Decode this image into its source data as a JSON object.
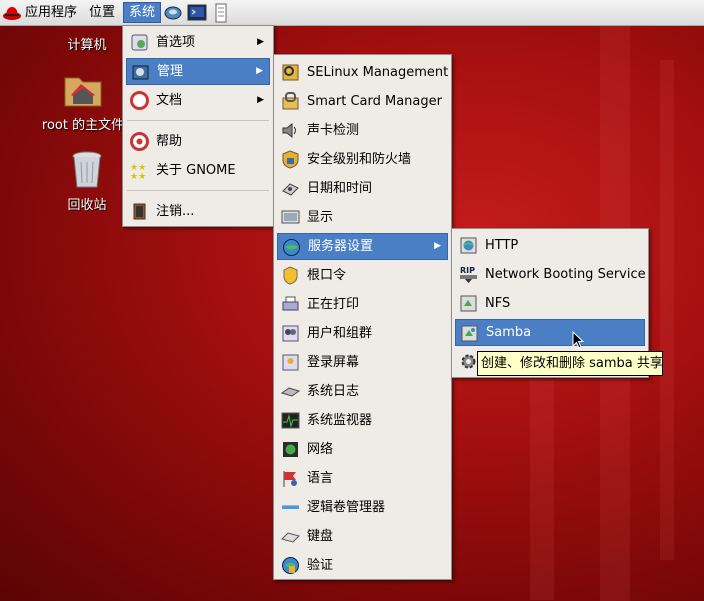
{
  "panel": {
    "menus": [
      "应用程序",
      "位置",
      "系统"
    ],
    "active_menu": "系统",
    "launchers": [
      "disk-launcher-icon",
      "terminal-launcher-icon",
      "notes-launcher-icon"
    ]
  },
  "desktop": {
    "icons": [
      {
        "label": "计算机",
        "icon": "computer-icon"
      },
      {
        "label": "root 的主文件",
        "icon": "home-folder-icon"
      },
      {
        "label": "回收站",
        "icon": "trash-icon"
      }
    ]
  },
  "system_menu": {
    "items": [
      {
        "label": "首选项",
        "icon": "preferences-icon",
        "submenu": true
      },
      {
        "label": "管理",
        "icon": "administration-icon",
        "submenu": true,
        "highlighted": true
      },
      {
        "label": "文档",
        "icon": "documents-icon",
        "submenu": true
      },
      {
        "label": "帮助",
        "icon": "help-icon"
      },
      {
        "label": "关于 GNOME",
        "icon": "gnome-icon"
      },
      {
        "label": "注销...",
        "icon": "logout-icon"
      }
    ]
  },
  "admin_menu": {
    "items": [
      {
        "label": "SELinux Management",
        "icon": "selinux-icon"
      },
      {
        "label": "Smart Card Manager",
        "icon": "smartcard-icon"
      },
      {
        "label": "声卡检测",
        "icon": "soundcard-icon"
      },
      {
        "label": "安全级别和防火墙",
        "icon": "firewall-icon"
      },
      {
        "label": "日期和时间",
        "icon": "date-time-icon"
      },
      {
        "label": "显示",
        "icon": "display-icon"
      },
      {
        "label": "服务器设置",
        "icon": "server-settings-icon",
        "submenu": true,
        "highlighted": true
      },
      {
        "label": "根口令",
        "icon": "root-password-icon"
      },
      {
        "label": "正在打印",
        "icon": "printer-icon"
      },
      {
        "label": "用户和组群",
        "icon": "users-groups-icon"
      },
      {
        "label": "登录屏幕",
        "icon": "login-screen-icon"
      },
      {
        "label": "系统日志",
        "icon": "system-log-icon"
      },
      {
        "label": "系统监视器",
        "icon": "system-monitor-icon"
      },
      {
        "label": "网络",
        "icon": "network-icon"
      },
      {
        "label": "语言",
        "icon": "language-icon"
      },
      {
        "label": "逻辑卷管理器",
        "icon": "lvm-icon"
      },
      {
        "label": "键盘",
        "icon": "keyboard-icon"
      },
      {
        "label": "验证",
        "icon": "authentication-icon"
      }
    ]
  },
  "server_menu": {
    "items": [
      {
        "label": "HTTP",
        "icon": "http-icon"
      },
      {
        "label": "Network Booting Service",
        "icon": "netboot-rip-icon"
      },
      {
        "label": "NFS",
        "icon": "nfs-icon"
      },
      {
        "label": "Samba",
        "icon": "samba-icon",
        "highlighted": true
      },
      {
        "label": "",
        "icon": "services-gear-icon"
      }
    ]
  },
  "tooltip": {
    "text": "创建、修改和删除 samba 共享"
  },
  "colors": {
    "highlight": "#4a7fc6",
    "menu_bg": "#efebe7",
    "desktop": "#a81010",
    "tooltip_bg": "#ffffc8"
  }
}
